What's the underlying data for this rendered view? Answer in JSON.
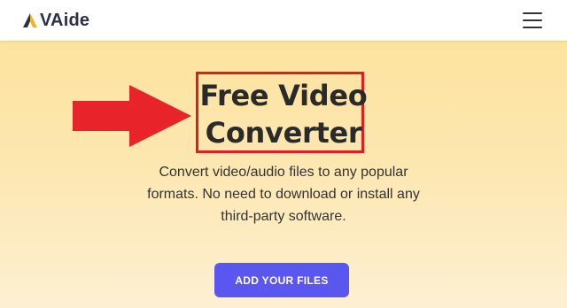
{
  "header": {
    "brand_name": "VAide",
    "logo_icon": "aviade-logo-icon",
    "menu_icon": "hamburger-menu-icon"
  },
  "hero": {
    "title_line1": "Free Video",
    "title_line2": "Converter",
    "subtitle_line1": "Convert video/audio files to any popular",
    "subtitle_line2": "formats. No need to download or install any",
    "subtitle_line3": "third-party software.",
    "cta_label": "ADD YOUR FILES",
    "annotation_arrow_icon": "red-arrow-icon"
  },
  "colors": {
    "hero_gradient_top": "#fde39f",
    "hero_gradient_bottom": "#fdf0d3",
    "accent_button": "#5a57f0",
    "annotation_red": "#e01e1e",
    "brand_text": "#2b2f4a",
    "logo_gold": "#f0b323"
  }
}
